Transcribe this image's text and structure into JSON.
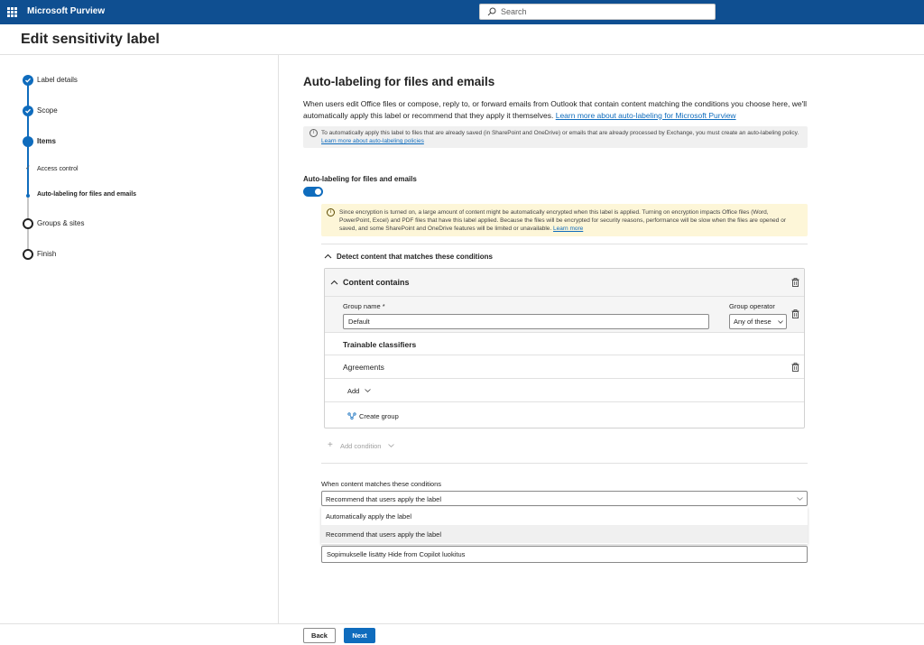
{
  "app": {
    "title": "Microsoft Purview"
  },
  "search": {
    "placeholder": "Search"
  },
  "page": {
    "title": "Edit sensitivity label"
  },
  "wizard": {
    "steps": [
      {
        "label": "Label details",
        "state": "done"
      },
      {
        "label": "Scope",
        "state": "done"
      },
      {
        "label": "Items",
        "state": "current"
      },
      {
        "label": "Access control",
        "state": "substep-done"
      },
      {
        "label": "Auto-labeling for files and emails",
        "state": "substep-current"
      },
      {
        "label": "Groups & sites",
        "state": "todo"
      },
      {
        "label": "Finish",
        "state": "todo"
      }
    ]
  },
  "main": {
    "heading": "Auto-labeling for files and emails",
    "description": "When users edit Office files or compose, reply to, or forward emails from Outlook that contain content matching the conditions you choose here, we'll automatically apply this label or recommend that they apply it themselves.",
    "description_link": "Learn more about auto-labeling for Microsoft Purview",
    "info_text": "To automatically apply this label to files that are already saved (in SharePoint and OneDrive) or emails that are already processed by Exchange, you must create an auto-labeling policy.",
    "info_link": "Learn more about auto-labeling policies",
    "toggle_label": "Auto-labeling for files and emails",
    "toggle_on": true,
    "warning_text": "Since encryption is turned on, a large amount of content might be automatically encrypted when this label is applied. Turning on encryption impacts Office files (Word, PowerPoint, Excel) and PDF files that have this label applied. Because the files will be encrypted for security reasons, performance will be slow when the files are opened or saved, and some SharePoint and OneDrive features will be limited or unavailable.",
    "warning_link": "Learn more",
    "detect_header": "Detect content that matches these conditions",
    "condition": {
      "title": "Content contains",
      "group_name_label": "Group name *",
      "group_name_value": "Default",
      "group_operator_label": "Group operator",
      "group_operator_value": "Any of these",
      "classifiers_header": "Trainable classifiers",
      "classifier": "Agreements",
      "add_label": "Add",
      "create_group_label": "Create group"
    },
    "add_condition_label": "Add condition",
    "when_label": "When content matches these conditions",
    "when_value": "Recommend that users apply the label",
    "dropdown_options": [
      "Automatically apply the label",
      "Recommend that users apply the label"
    ],
    "message_value": "Sopimukselle lisätty Hide from Copilot luokitus"
  },
  "footer": {
    "back_label": "Back",
    "next_label": "Next"
  },
  "colors": {
    "brand": "#0f4f91",
    "accent": "#0f6cbd",
    "warning_bg": "#fdf6d8"
  }
}
